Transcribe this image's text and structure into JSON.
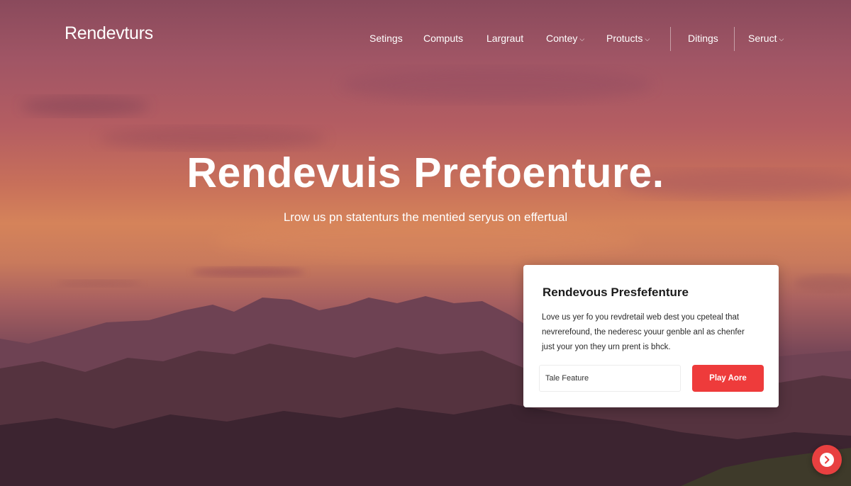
{
  "brand": {
    "logo_text": "Rendevturs"
  },
  "nav": {
    "items": [
      {
        "label": "Setings",
        "has_dropdown": false
      },
      {
        "label": "Computs",
        "has_dropdown": false
      },
      {
        "label": "Largraut",
        "has_dropdown": false
      },
      {
        "label": "Contey",
        "has_dropdown": true
      },
      {
        "label": "Protucts",
        "has_dropdown": true
      },
      {
        "label": "Ditings",
        "has_dropdown": false
      },
      {
        "label": "Seruct",
        "has_dropdown": true
      }
    ],
    "chevron_glyph": "⌄"
  },
  "hero": {
    "title": "Rendevuis Prefoenture.",
    "subtitle": "Lrow us pn statenturs the mentied seryus on effertual"
  },
  "card": {
    "title": "Rendevous Presfefenture",
    "body_lines": [
      "Love us yer fo you revdretail web dest you cpeteal that",
      "nevrerefound, the nederesc youur genble anl as chenfer",
      "just your yon they urn prent is bhck."
    ],
    "input_value": "Tale Feature",
    "button_label": "Play Aore"
  },
  "fab": {
    "icon": "chevron-right-icon"
  },
  "colors": {
    "accent": "#ee3b3b",
    "card_bg": "#ffffff",
    "text_on_hero": "#ffffff"
  }
}
